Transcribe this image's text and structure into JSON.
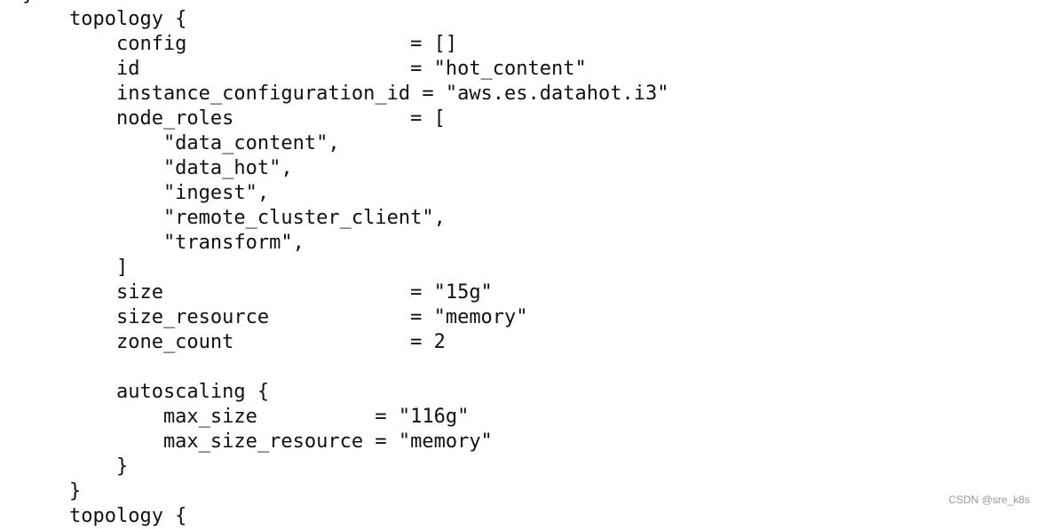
{
  "code": {
    "lines": [
      "}",
      "    topology {",
      "        config                   = []",
      "        id                       = \"hot_content\"",
      "        instance_configuration_id = \"aws.es.datahot.i3\"",
      "        node_roles               = [",
      "            \"data_content\",",
      "            \"data_hot\",",
      "            \"ingest\",",
      "            \"remote_cluster_client\",",
      "            \"transform\",",
      "        ]",
      "        size                     = \"15g\"",
      "        size_resource            = \"memory\"",
      "        zone_count               = 2",
      "",
      "        autoscaling {",
      "            max_size          = \"116g\"",
      "            max_size_resource = \"memory\"",
      "        }",
      "    }",
      "    topology {"
    ]
  },
  "watermark": "CSDN @sre_k8s"
}
